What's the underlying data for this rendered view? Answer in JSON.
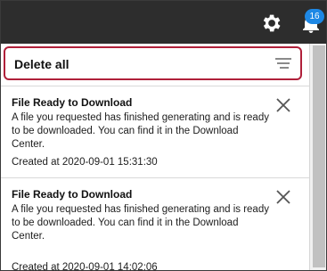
{
  "topbar": {
    "settings_icon": "gear-icon",
    "notifications_icon": "bell-icon",
    "notification_count": "16"
  },
  "panel": {
    "delete_all_label": "Delete all",
    "sort_icon": "sort-lines-icon"
  },
  "notifications": [
    {
      "title": "File Ready to Download",
      "body": "A file you requested has finished generating and is ready to be downloaded. You can find it in the Download Center.",
      "created": "Created at 2020-09-01 15:31:30"
    },
    {
      "title": "File Ready to Download",
      "body": "A file you requested has finished generating and is ready to be downloaded. You can find it in the Download Center.",
      "created": "Created at 2020-09-01 14:02:06"
    }
  ],
  "colors": {
    "topbar": "#2d2d2d",
    "badge": "#1e88e5",
    "highlight_border": "#b0203a"
  }
}
